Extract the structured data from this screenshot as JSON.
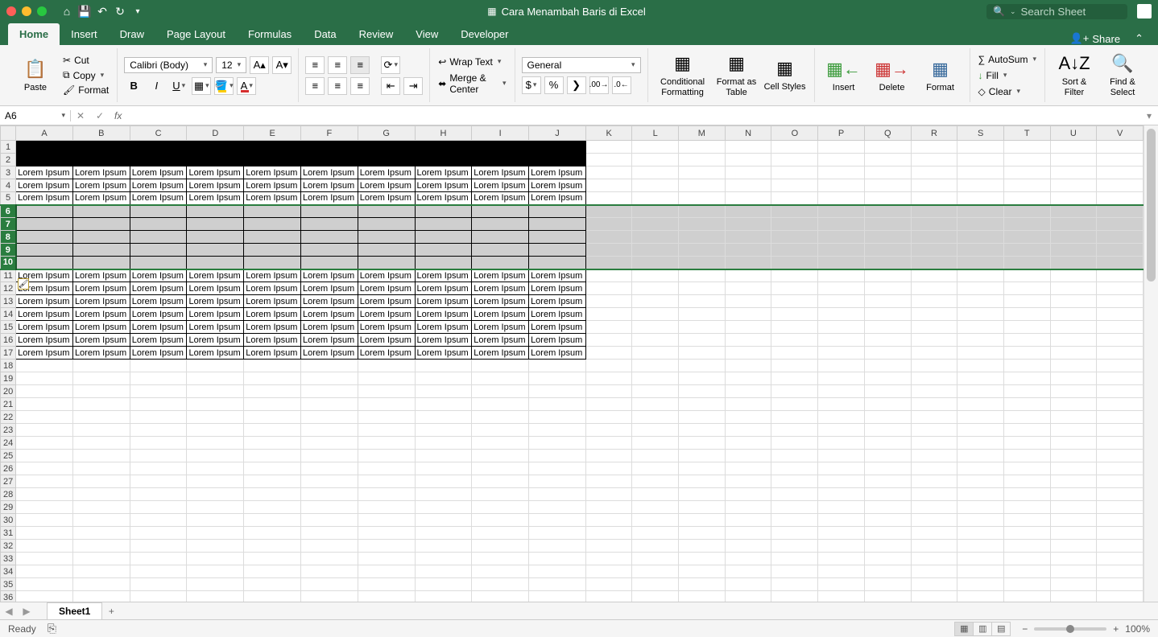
{
  "titlebar": {
    "doc_title": "Cara Menambah Baris di Excel",
    "search_placeholder": "Search Sheet"
  },
  "tabs": {
    "items": [
      "Home",
      "Insert",
      "Draw",
      "Page Layout",
      "Formulas",
      "Data",
      "Review",
      "View",
      "Developer"
    ],
    "active_index": 0,
    "share": "Share"
  },
  "ribbon": {
    "paste": "Paste",
    "cut": "Cut",
    "copy": "Copy",
    "format_painter": "Format",
    "font_name": "Calibri (Body)",
    "font_size": "12",
    "wrap_text": "Wrap Text",
    "merge_center": "Merge & Center",
    "number_format": "General",
    "cond_fmt": "Conditional Formatting",
    "fmt_table": "Format as Table",
    "cell_styles": "Cell Styles",
    "insert": "Insert",
    "delete": "Delete",
    "format": "Format",
    "autosum": "AutoSum",
    "fill": "Fill",
    "clear": "Clear",
    "sort_filter": "Sort & Filter",
    "find_select": "Find & Select"
  },
  "formula_bar": {
    "name_box": "A6",
    "fx": "fx"
  },
  "sheet": {
    "columns": [
      "A",
      "B",
      "C",
      "D",
      "E",
      "F",
      "G",
      "H",
      "I",
      "J",
      "K",
      "L",
      "M",
      "N",
      "O",
      "P",
      "Q",
      "R",
      "S",
      "T",
      "U",
      "V"
    ],
    "col_widths": {
      "default": 65,
      "first": 35,
      "std": 71
    },
    "total_rows": 36,
    "selected_rows": [
      6,
      7,
      8,
      9,
      10
    ],
    "data_rows_black": [
      1,
      2
    ],
    "data_cols": 10,
    "cell_text": "Lorem Ipsum",
    "text_rows": [
      3,
      4,
      5,
      11,
      12,
      13,
      14,
      15,
      16,
      17
    ],
    "bordered_empty_rows": [
      6,
      7,
      8,
      9,
      10
    ]
  },
  "tabstrip": {
    "sheet_name": "Sheet1"
  },
  "status": {
    "ready": "Ready",
    "zoom": "100%"
  }
}
